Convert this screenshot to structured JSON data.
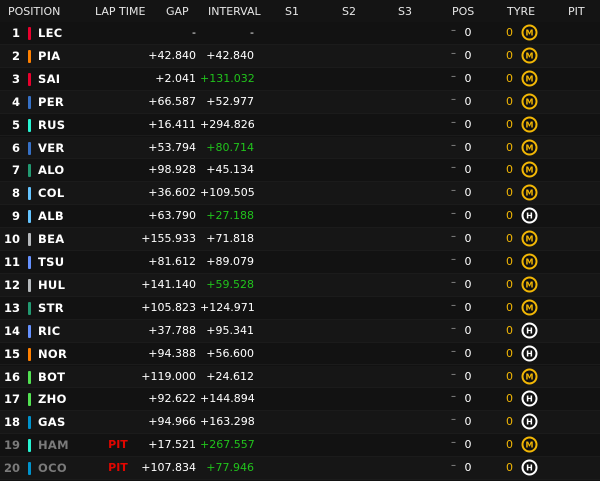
{
  "header": {
    "position": "POSITION",
    "lap_time": "LAP TIME",
    "gap": "GAP",
    "interval": "INTERVAL",
    "s1": "S1",
    "s2": "S2",
    "s3": "S3",
    "pos": "POS",
    "tyre": "TYRE",
    "pit": "PIT"
  },
  "colors": {
    "interval_gain": "#21c21c",
    "pit": "#e10600",
    "tyre_medium": "#f2b705",
    "tyre_hard": "#ffffff"
  },
  "rows": [
    {
      "pos": "1",
      "driver": "LEC",
      "team_color": "#e8002d",
      "lap": "",
      "gap": "-",
      "interval": "-",
      "interval_green": false,
      "pos_change": "0",
      "tyre_age": "0",
      "tyre": "M",
      "tyre_icon": "medium-tyre-icon"
    },
    {
      "pos": "2",
      "driver": "PIA",
      "team_color": "#ff8000",
      "lap": "",
      "gap": "+42.840",
      "interval": "+42.840",
      "interval_green": false,
      "pos_change": "0",
      "tyre_age": "0",
      "tyre": "M",
      "tyre_icon": "medium-tyre-icon"
    },
    {
      "pos": "3",
      "driver": "SAI",
      "team_color": "#e8002d",
      "lap": "",
      "gap": "+2.041",
      "interval": "+131.032",
      "interval_green": true,
      "pos_change": "0",
      "tyre_age": "0",
      "tyre": "M",
      "tyre_icon": "medium-tyre-icon"
    },
    {
      "pos": "4",
      "driver": "PER",
      "team_color": "#3671c6",
      "lap": "",
      "gap": "+66.587",
      "interval": "+52.977",
      "interval_green": false,
      "pos_change": "0",
      "tyre_age": "0",
      "tyre": "M",
      "tyre_icon": "medium-tyre-icon"
    },
    {
      "pos": "5",
      "driver": "RUS",
      "team_color": "#27f4d2",
      "lap": "",
      "gap": "+16.411",
      "interval": "+294.826",
      "interval_green": false,
      "pos_change": "0",
      "tyre_age": "0",
      "tyre": "M",
      "tyre_icon": "medium-tyre-icon"
    },
    {
      "pos": "6",
      "driver": "VER",
      "team_color": "#3671c6",
      "lap": "",
      "gap": "+53.794",
      "interval": "+80.714",
      "interval_green": true,
      "pos_change": "0",
      "tyre_age": "0",
      "tyre": "M",
      "tyre_icon": "medium-tyre-icon"
    },
    {
      "pos": "7",
      "driver": "ALO",
      "team_color": "#229971",
      "lap": "",
      "gap": "+98.928",
      "interval": "+45.134",
      "interval_green": false,
      "pos_change": "0",
      "tyre_age": "0",
      "tyre": "M",
      "tyre_icon": "medium-tyre-icon"
    },
    {
      "pos": "8",
      "driver": "COL",
      "team_color": "#64c4ff",
      "lap": "",
      "gap": "+36.602",
      "interval": "+109.505",
      "interval_green": false,
      "pos_change": "0",
      "tyre_age": "0",
      "tyre": "M",
      "tyre_icon": "medium-tyre-icon"
    },
    {
      "pos": "9",
      "driver": "ALB",
      "team_color": "#64c4ff",
      "lap": "",
      "gap": "+63.790",
      "interval": "+27.188",
      "interval_green": true,
      "pos_change": "0",
      "tyre_age": "0",
      "tyre": "H",
      "tyre_icon": "hard-tyre-icon"
    },
    {
      "pos": "10",
      "driver": "BEA",
      "team_color": "#b6babd",
      "lap": "",
      "gap": "+155.933",
      "interval": "+71.818",
      "interval_green": false,
      "pos_change": "0",
      "tyre_age": "0",
      "tyre": "M",
      "tyre_icon": "medium-tyre-icon"
    },
    {
      "pos": "11",
      "driver": "TSU",
      "team_color": "#6692ff",
      "lap": "",
      "gap": "+81.612",
      "interval": "+89.079",
      "interval_green": false,
      "pos_change": "0",
      "tyre_age": "0",
      "tyre": "M",
      "tyre_icon": "medium-tyre-icon"
    },
    {
      "pos": "12",
      "driver": "HUL",
      "team_color": "#b6babd",
      "lap": "",
      "gap": "+141.140",
      "interval": "+59.528",
      "interval_green": true,
      "pos_change": "0",
      "tyre_age": "0",
      "tyre": "M",
      "tyre_icon": "medium-tyre-icon"
    },
    {
      "pos": "13",
      "driver": "STR",
      "team_color": "#229971",
      "lap": "",
      "gap": "+105.823",
      "interval": "+124.971",
      "interval_green": false,
      "pos_change": "0",
      "tyre_age": "0",
      "tyre": "M",
      "tyre_icon": "medium-tyre-icon"
    },
    {
      "pos": "14",
      "driver": "RIC",
      "team_color": "#6692ff",
      "lap": "",
      "gap": "+37.788",
      "interval": "+95.341",
      "interval_green": false,
      "pos_change": "0",
      "tyre_age": "0",
      "tyre": "H",
      "tyre_icon": "hard-tyre-icon"
    },
    {
      "pos": "15",
      "driver": "NOR",
      "team_color": "#ff8000",
      "lap": "",
      "gap": "+94.388",
      "interval": "+56.600",
      "interval_green": false,
      "pos_change": "0",
      "tyre_age": "0",
      "tyre": "H",
      "tyre_icon": "hard-tyre-icon"
    },
    {
      "pos": "16",
      "driver": "BOT",
      "team_color": "#52e252",
      "lap": "",
      "gap": "+119.000",
      "interval": "+24.612",
      "interval_green": false,
      "pos_change": "0",
      "tyre_age": "0",
      "tyre": "M",
      "tyre_icon": "medium-tyre-icon"
    },
    {
      "pos": "17",
      "driver": "ZHO",
      "team_color": "#52e252",
      "lap": "",
      "gap": "+92.622",
      "interval": "+144.894",
      "interval_green": false,
      "pos_change": "0",
      "tyre_age": "0",
      "tyre": "H",
      "tyre_icon": "hard-tyre-icon"
    },
    {
      "pos": "18",
      "driver": "GAS",
      "team_color": "#0093cc",
      "lap": "",
      "gap": "+94.966",
      "interval": "+163.298",
      "interval_green": false,
      "pos_change": "0",
      "tyre_age": "0",
      "tyre": "H",
      "tyre_icon": "hard-tyre-icon"
    },
    {
      "pos": "19",
      "driver": "HAM",
      "team_color": "#27f4d2",
      "lap": "PIT",
      "gap": "+17.521",
      "interval": "+267.557",
      "interval_green": true,
      "pos_change": "0",
      "tyre_age": "0",
      "tyre": "M",
      "tyre_icon": "medium-tyre-icon",
      "dimmed": true
    },
    {
      "pos": "20",
      "driver": "OCO",
      "team_color": "#0093cc",
      "lap": "PIT",
      "gap": "+107.834",
      "interval": "+77.946",
      "interval_green": true,
      "pos_change": "0",
      "tyre_age": "0",
      "tyre": "H",
      "tyre_icon": "hard-tyre-icon",
      "dimmed": true
    }
  ]
}
